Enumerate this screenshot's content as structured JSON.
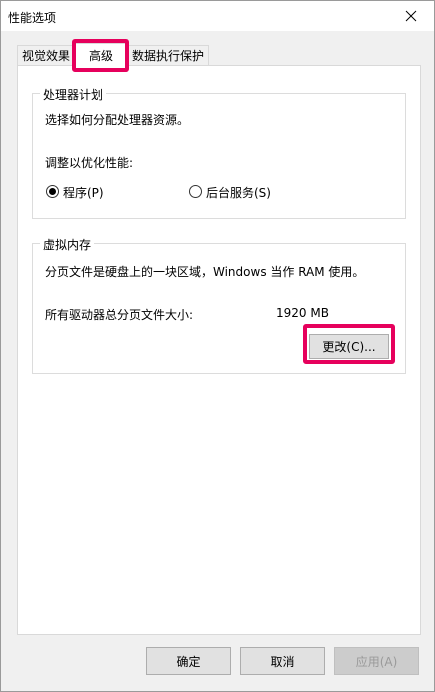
{
  "window": {
    "title": "性能选项"
  },
  "tabs": [
    {
      "label": "视觉效果"
    },
    {
      "label": "高级"
    },
    {
      "label": "数据执行保护"
    }
  ],
  "processor_scheduling": {
    "legend": "处理器计划",
    "description": "选择如何分配处理器资源。",
    "adjust_label": "调整以优化性能:",
    "options": [
      {
        "label": "程序(P)",
        "checked": true
      },
      {
        "label": "后台服务(S)",
        "checked": false
      }
    ]
  },
  "virtual_memory": {
    "legend": "虚拟内存",
    "description": "分页文件是硬盘上的一块区域，Windows 当作 RAM 使用。",
    "total_label": "所有驱动器总分页文件大小:",
    "total_value": "1920 MB",
    "change_button": "更改(C)..."
  },
  "footer": {
    "ok": "确定",
    "cancel": "取消",
    "apply": "应用(A)"
  },
  "colors": {
    "highlight": "#e6005c"
  }
}
